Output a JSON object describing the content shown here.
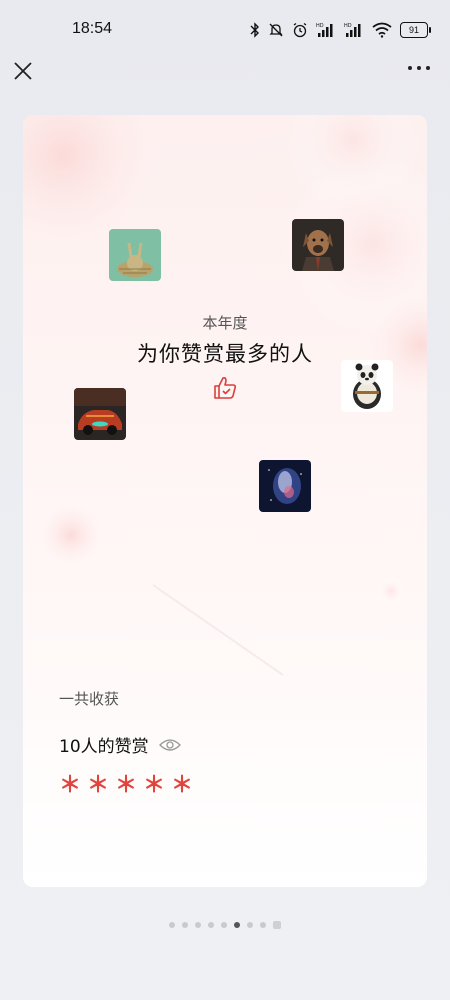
{
  "status_bar": {
    "time": "18:54",
    "battery": "91",
    "icons": [
      "bluetooth-icon",
      "mute-icon",
      "alarm-icon",
      "signal-hd-icon",
      "signal-hd-icon",
      "wifi-icon",
      "battery-icon"
    ]
  },
  "nav": {
    "close_icon": "close-icon",
    "more_icon": "more-icon"
  },
  "card": {
    "year_label": "本年度",
    "headline": "为你赞赏最多的人",
    "thumb_icon": "thumbs-up-icon",
    "avatars": [
      "rabbit-avatar",
      "dog-avatar",
      "panda-avatar",
      "car-avatar",
      "nebula-avatar"
    ],
    "total_label": "一共收获",
    "count_text": "10人的赞赏",
    "eye_icon": "eye-icon",
    "masked_amount": "＊＊＊＊＊"
  },
  "pager": {
    "total": 9,
    "active_index": 5
  },
  "colors": {
    "accent_red": "#e0443c",
    "background": "#eceef2",
    "card": "#ffffff"
  }
}
